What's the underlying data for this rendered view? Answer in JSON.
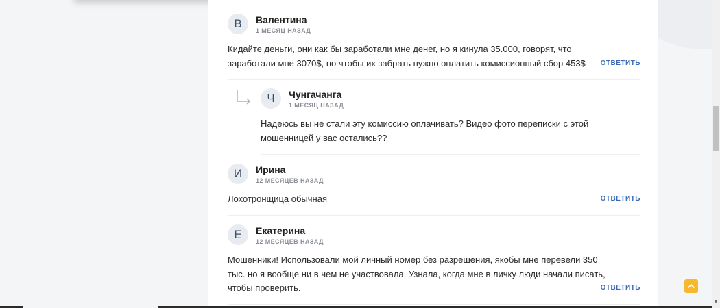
{
  "reply_button_label": "ОТВЕТИТЬ",
  "comments": [
    {
      "avatar_letter": "В",
      "author": "Валентина",
      "date": "1 МЕСЯЦ НАЗАД",
      "text_lines": [
        "Кидайте деньги, они как бы заработали мне денег, но я кинула 35.000, говорят, что",
        "заработали мне 3070$, но чтобы их забрать нужно оплатить комиссионный сбор 453$"
      ]
    },
    {
      "avatar_letter": "Ч",
      "author": "Чунгачанга",
      "date": "1 МЕСЯЦ НАЗАД",
      "text_lines": [
        "Надеюсь вы не стали эту комиссию оплачивать? Видео фото переписки с этой",
        "мошенницей у вас остались??"
      ]
    },
    {
      "avatar_letter": "И",
      "author": "Ирина",
      "date": "12 МЕСЯЦЕВ НАЗАД",
      "text_lines": [
        "Лохотронщица обычная"
      ]
    },
    {
      "avatar_letter": "Е",
      "author": "Екатерина",
      "date": "12 МЕСЯЦЕВ НАЗАД",
      "text_lines": [
        "Мошенники! Использовали мой личный номер без разрешения, якобы мне перевели 350",
        "тыс. но я вообще ни в чем не участвовала. Узнала, когда мне в личку люди начали писать,",
        "чтобы проверить."
      ]
    }
  ],
  "colors": {
    "reply_link": "#3a6ab8",
    "to_top_button": "#f5b82e",
    "avatar_bg": "#e8ecf1"
  },
  "icons": {
    "reply_arrow": "reply-arrow-icon",
    "scroll_top": "chevron-up-icon",
    "scroll_down": "triangle-down-icon"
  }
}
